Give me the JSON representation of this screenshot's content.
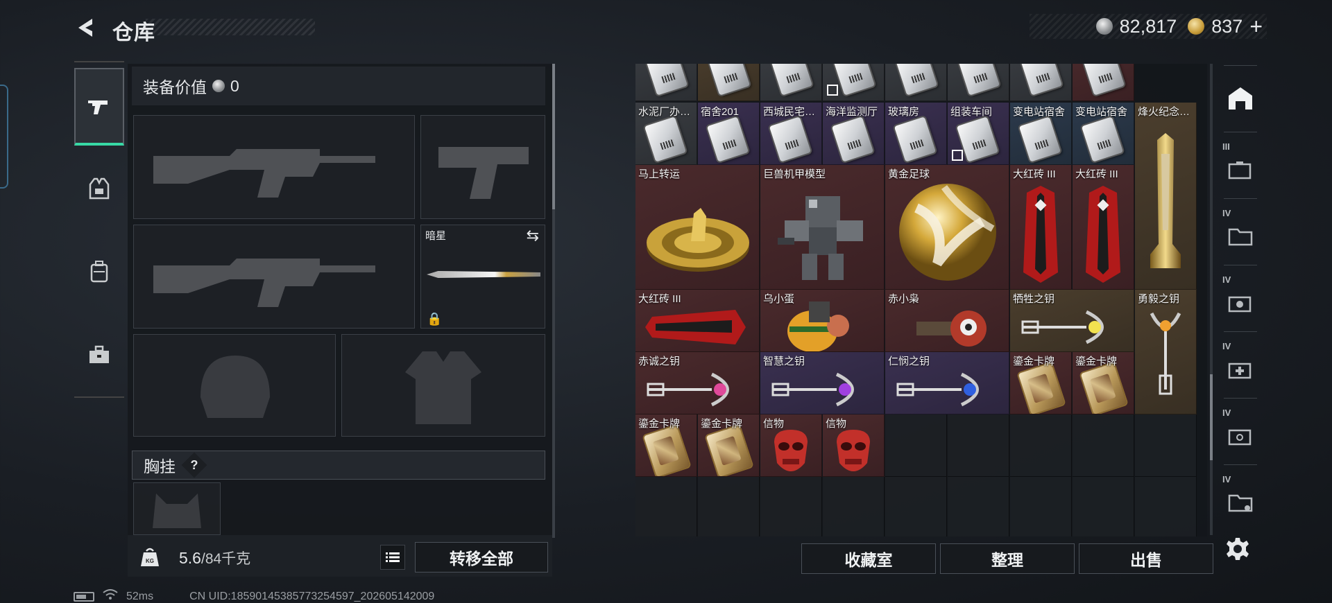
{
  "header": {
    "title": "仓库",
    "silver_value": "82,817",
    "gold_value": "837",
    "plus_label": "+"
  },
  "left_tabs": [
    {
      "name": "weapon-tab",
      "icon": "pistol-icon",
      "active": true
    },
    {
      "name": "armor-tab",
      "icon": "vest-icon",
      "active": false
    },
    {
      "name": "backpack-tab",
      "icon": "backpack-icon",
      "active": false
    },
    {
      "name": "toolbox-tab",
      "icon": "toolbox-icon",
      "active": false
    }
  ],
  "equipment": {
    "value_label": "装备价值",
    "value": "0",
    "melee_name": "暗星",
    "chest_label": "胸挂",
    "help_label": "?"
  },
  "footer_left": {
    "weight_current": "5.6",
    "weight_total": "/84千克",
    "transfer_all": "转移全部"
  },
  "grid": {
    "row0": [
      {
        "label": "",
        "bg": "grey"
      },
      {
        "label": "",
        "bg": "gold"
      },
      {
        "label": "",
        "bg": "grey"
      },
      {
        "label": "",
        "bg": "grey"
      },
      {
        "label": "",
        "bg": "grey"
      },
      {
        "label": "",
        "bg": "grey"
      },
      {
        "label": "",
        "bg": "grey"
      },
      {
        "label": "",
        "bg": "red"
      }
    ],
    "row1": [
      {
        "label": "水泥厂办…",
        "bg": "grey"
      },
      {
        "label": "宿舍201",
        "bg": "purple"
      },
      {
        "label": "西城民宅…",
        "bg": "purple"
      },
      {
        "label": "海洋监测厅",
        "bg": "purple"
      },
      {
        "label": "玻璃房",
        "bg": "purple"
      },
      {
        "label": "组装车间",
        "bg": "purple"
      },
      {
        "label": "变电站宿舍",
        "bg": "blue"
      },
      {
        "label": "变电站宿舍",
        "bg": "blue"
      }
    ],
    "big_row": {
      "mashangzhuanyun": "马上转运",
      "jushou": "巨兽机甲模型",
      "huangjinzuqiu": "黄金足球",
      "dahongzhuan1": "大红砖 III",
      "dahongzhuan2": "大红砖 III",
      "fenghuo": "烽火纪念…"
    },
    "row_mid": {
      "dahongzhuan3": "大红砖 III",
      "wuxiaodan": "乌小蛋",
      "chixiaoxiao": "赤小枭",
      "xishengzhiyao": "牺牲之钥",
      "yongyizhiyao": "勇毅之钥"
    },
    "row_keys": {
      "chichengzhiyao": "赤诚之钥",
      "zhihuizhiyao": "智慧之钥",
      "renminzhiyao": "仁悯之钥",
      "jinpai1": "鎏金卡牌",
      "jinpai2": "鎏金卡牌"
    },
    "row_last": {
      "jinpai3": "鎏金卡牌",
      "jinpai4": "鎏金卡牌",
      "xinwu1": "信物",
      "xinwu2": "信物"
    }
  },
  "buttons": {
    "collection": "收藏室",
    "sort": "整理",
    "sell": "出售"
  },
  "right_tabs": [
    {
      "name": "home-tab",
      "roman": ""
    },
    {
      "name": "tab-III",
      "roman": "III"
    },
    {
      "name": "tab-IV-a",
      "roman": "IV"
    },
    {
      "name": "tab-IV-b",
      "roman": "IV"
    },
    {
      "name": "tab-IV-c",
      "roman": "IV"
    },
    {
      "name": "tab-IV-d",
      "roman": "IV"
    },
    {
      "name": "tab-IV-e",
      "roman": "IV"
    }
  ],
  "status": {
    "ping": "52ms",
    "uid": "CN UID:185901453857732545​97_202605142009"
  },
  "colors": {
    "accent": "#38d9a5",
    "red_rarity": "#4a2a2c",
    "gold_rarity": "#4b3e2d",
    "purple_rarity": "#3a3050",
    "blue_rarity": "#2c3a4c"
  }
}
